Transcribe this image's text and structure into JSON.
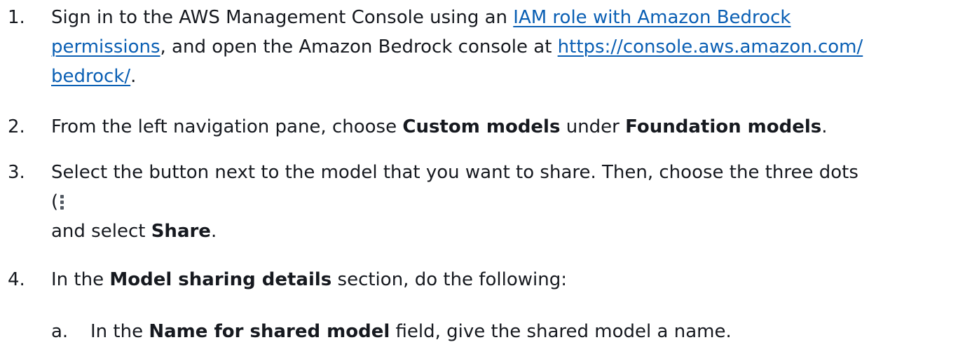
{
  "steps": [
    {
      "number": "1.",
      "lines": {
        "l1_prefix": "Sign in to the AWS Management Console using an ",
        "l1_link": "IAM role with Amazon Bedrock",
        "l2_link": "permissions",
        "l2_mid": ", and open the Amazon Bedrock console at ",
        "l2_url": "https://console.aws.amazon.com/",
        "l3_url": "bedrock/",
        "l3_end": "."
      }
    },
    {
      "number": "2.",
      "lines": {
        "prefix": "From the left navigation pane, choose ",
        "bold1": "Custom models",
        "mid": " under ",
        "bold2": "Foundation models",
        "end": "."
      }
    },
    {
      "number": "3.",
      "lines": {
        "l1": "Select the button next to the model that you want to share. Then, choose the three dots",
        "l2_open": "(",
        "l2_icon": "more-options-dots",
        "l3_prefix": "and select ",
        "l3_bold": "Share",
        "l3_end": "."
      }
    },
    {
      "number": "4.",
      "lines": {
        "prefix": "In the ",
        "bold": "Model sharing details",
        "end": " section, do the following:"
      }
    },
    {
      "number": "a.",
      "lines": {
        "prefix": "In the ",
        "bold": "Name for shared model",
        "end": " field, give the shared model a name."
      }
    }
  ]
}
